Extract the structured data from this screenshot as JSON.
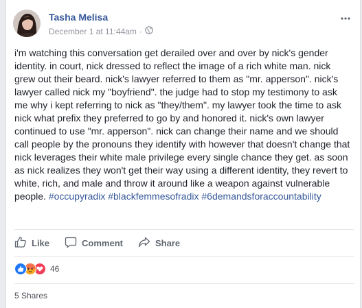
{
  "post": {
    "author": "Tasha Melisa",
    "timestamp": "December 1 at 11:44am",
    "separator": "·",
    "privacy_icon": "globe-icon",
    "menu_icon": "ellipsis-icon",
    "body": "i'm watching this conversation get derailed over and over by nick's gender identity. in court, nick dressed to reflect the image of a rich white man. nick grew out their beard. nick's lawyer referred to them as \"mr. apperson\". nick's lawyer called nick my \"boyfriend\". the judge had to stop my testimony to ask me why i kept referring to nick as \"they/them\". my lawyer took the time to ask nick what prefix they preferred to go by and honored it. nick's own lawyer continued to use \"mr. apperson\". nick can change their name and we should call people by the pronouns they identify with however that doesn't change that nick leverages their white male privilege every single chance they get. as soon as nick realizes they won't get their way using a different identity, they revert to white, rich, and male and throw it around like a weapon against vulnerable people.",
    "hashtags": [
      "#occupyradix",
      "#blackfemmesofradix",
      "#6demandsforaccountability"
    ]
  },
  "actions": {
    "like": "Like",
    "comment": "Comment",
    "share": "Share"
  },
  "reactions": {
    "types": [
      "like",
      "angry",
      "love"
    ],
    "colors": {
      "like": "#2078f4",
      "angry": "#f7714b",
      "love": "#f33e58"
    },
    "count": "46"
  },
  "shares": "5 Shares"
}
